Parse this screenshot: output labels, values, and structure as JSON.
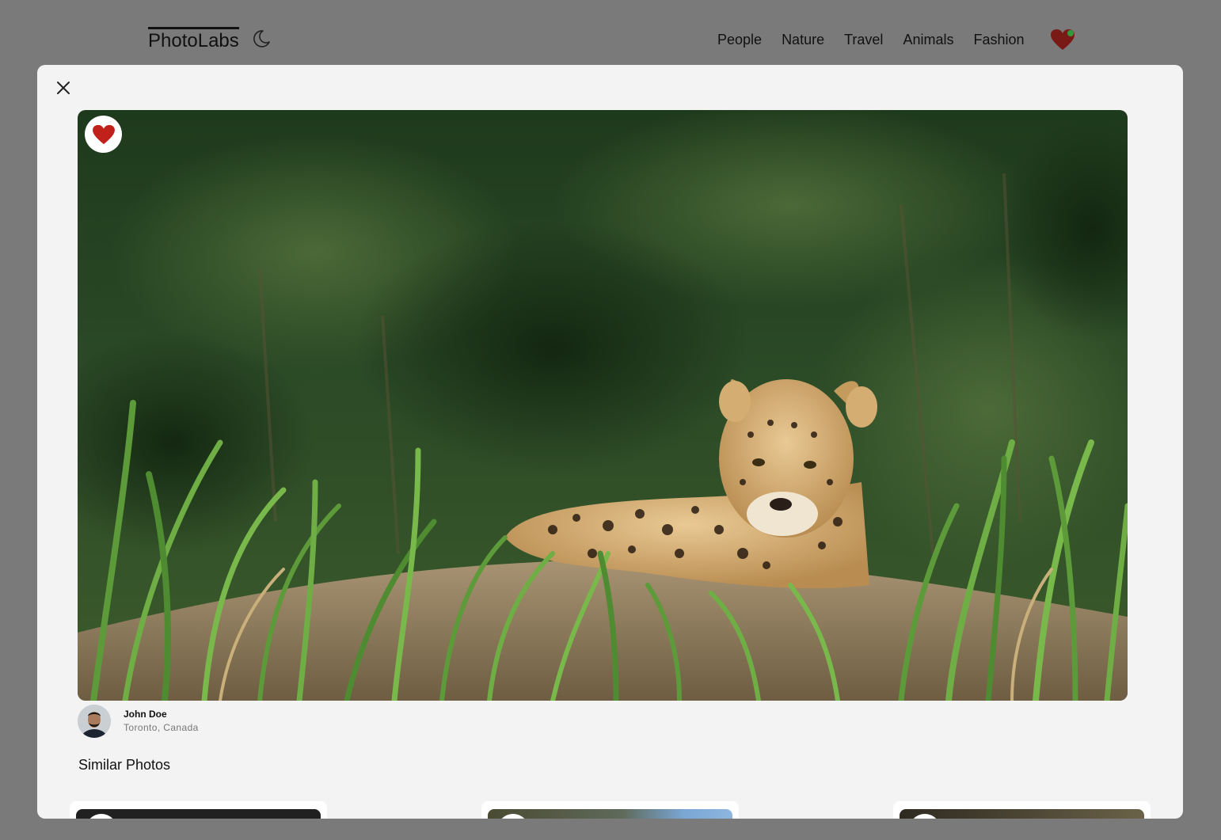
{
  "app": {
    "logo": "PhotoLabs",
    "theme_icon": "moon-icon",
    "topics": [
      "People",
      "Nature",
      "Travel",
      "Animals",
      "Fashion"
    ],
    "fav_icon": "heart-icon",
    "fav_has_notification": true
  },
  "modal": {
    "close_icon": "close-icon",
    "photo": {
      "subject": "jaguar-in-grass",
      "liked": true,
      "like_icon": "heart-icon"
    },
    "user": {
      "name": "John Doe",
      "location": "Toronto, Canada"
    },
    "similar_title": "Similar Photos",
    "similar_count": 3
  },
  "colors": {
    "heart": "#c1211b",
    "overlay": "#7a7a7a",
    "modal_bg": "#f3f3f3",
    "notification": "#2e9c3f"
  }
}
